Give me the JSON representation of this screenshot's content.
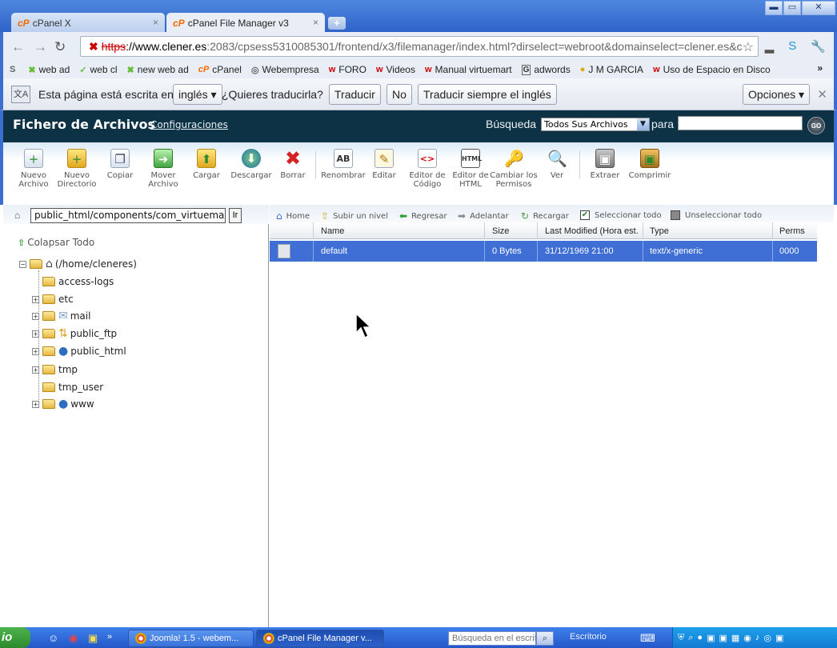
{
  "browser": {
    "tabs": [
      {
        "favicon": "cP",
        "title": "cPanel X",
        "close": "×"
      },
      {
        "favicon": "cP",
        "title": "cPanel File Manager v3",
        "close": "×"
      }
    ],
    "new_tab": "+",
    "window_controls": {
      "minimize": "▬",
      "maximize": "▭",
      "close": "✕"
    },
    "url": {
      "proto": "https",
      "host": "://www.clener.es",
      "path": ":2083/cpsess5310085301/frontend/x3/filemanager/index.html?dirselect=webroot&domainselect=clener.es&c"
    },
    "bookmarks": [
      {
        "icon": "S",
        "label": "",
        "icon_class": "gl"
      },
      {
        "icon": "✖",
        "label": "web ad",
        "icon_class": "x"
      },
      {
        "icon": "✓",
        "label": "web cl",
        "icon_class": "x"
      },
      {
        "icon": "✖",
        "label": "new web ad",
        "icon_class": "x"
      },
      {
        "icon": "cP",
        "label": "cPanel",
        "icon_class": "cp"
      },
      {
        "icon": "◎",
        "label": "Webempresa",
        "icon_class": "gl"
      },
      {
        "icon": "w",
        "label": "FORO",
        "icon_class": "w"
      },
      {
        "icon": "w",
        "label": "Videos",
        "icon_class": "w"
      },
      {
        "icon": "w",
        "label": "Manual virtuemart",
        "icon_class": "w"
      },
      {
        "icon": "G",
        "label": "adwords",
        "icon_class": "g"
      },
      {
        "icon": "●",
        "label": "J M GARCIA",
        "icon_class": "dot"
      },
      {
        "icon": "w",
        "label": "Uso de Espacio en Disco",
        "icon_class": "w"
      }
    ],
    "bookmarks_more": "»"
  },
  "translate": {
    "icon": "文A",
    "message": "Esta página está escrita en",
    "language": "inglés ▾",
    "question": "¿Quieres traducirla?",
    "translate_btn": "Traducir",
    "no_btn": "No",
    "always_btn": "Traducir siempre el inglés",
    "options_btn": "Opciones ▾",
    "close": "✕"
  },
  "cpanel": {
    "title": "Fichero de Archivos",
    "config_link": "Configuraciones",
    "search_label": "Búsqueda",
    "search_scope": "Todos Sus Archivos",
    "para_label": "para",
    "go_btn": "GO",
    "tools": [
      {
        "glyph": "+",
        "label": "Nuevo Archivo"
      },
      {
        "glyph": "+",
        "label": "Nuevo Directorio"
      },
      {
        "glyph": "❐",
        "label": "Copiar"
      },
      {
        "glyph": "➜",
        "label": "Mover Archivo"
      },
      {
        "glyph": "⬆",
        "label": "Cargar"
      },
      {
        "glyph": "⬇",
        "label": "Descargar"
      },
      {
        "glyph": "✖",
        "label": "Borrar"
      },
      {
        "glyph": "AB",
        "label": "Renombrar"
      },
      {
        "glyph": "✎",
        "label": "Editar"
      },
      {
        "glyph": "<>",
        "label": "Editor de Código"
      },
      {
        "glyph": "HTML",
        "label": "Editor de HTML"
      },
      {
        "glyph": "🔑",
        "label": "Cambiar los Permisos"
      },
      {
        "glyph": "🔍",
        "label": "Ver"
      },
      {
        "glyph": "▣",
        "label": "Extraer"
      },
      {
        "glyph": "▣",
        "label": "Comprimir"
      }
    ],
    "path_value": "public_html/components/com_virtuemart",
    "path_go": "Ir",
    "nav": {
      "home": "Home",
      "up": "Subir un nivel",
      "back": "Regresar",
      "forward": "Adelantar",
      "reload": "Recargar",
      "select_all": "Seleccionar todo",
      "unselect_all": "Unseleccionar todo"
    },
    "tree": {
      "collapse_all": "Colapsar Todo",
      "root": "(/home/cleneres)",
      "items": [
        {
          "name": "access-logs"
        },
        {
          "name": "etc"
        },
        {
          "name": "mail"
        },
        {
          "name": "public_ftp"
        },
        {
          "name": "public_html"
        },
        {
          "name": "tmp"
        },
        {
          "name": "tmp_user"
        },
        {
          "name": "www"
        }
      ]
    },
    "table": {
      "columns": [
        "Name",
        "Size",
        "Last Modified (Hora est. d",
        "Type",
        "Perms"
      ],
      "rows": [
        {
          "name": "default",
          "size": "0 Bytes",
          "modified": "31/12/1969 21:00",
          "type": "text/x-generic",
          "perms": "0000"
        }
      ]
    }
  },
  "taskbar": {
    "start": "io",
    "windows": [
      {
        "title": "Joomla! 1.5 - webem..."
      },
      {
        "title": "cPanel File Manager v..."
      }
    ],
    "search_placeholder": "Búsqueda en el escrito",
    "desktop_label": "Escritorio"
  }
}
